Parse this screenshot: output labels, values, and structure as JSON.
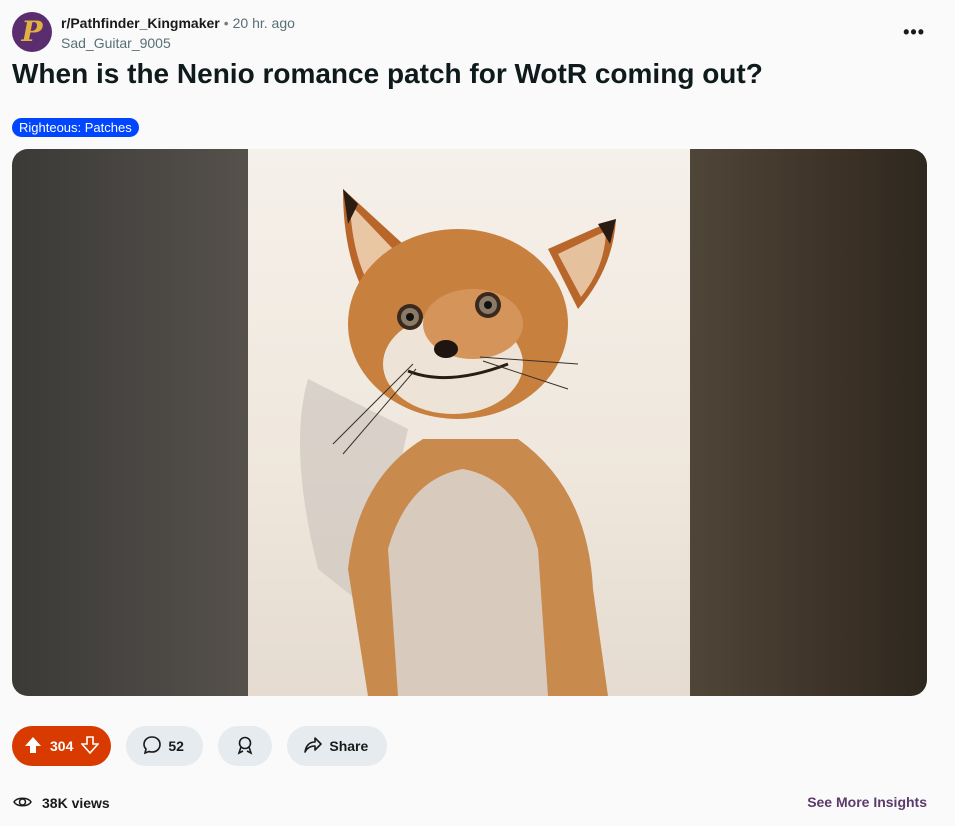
{
  "post": {
    "subreddit": "r/Pathfinder_Kingmaker",
    "separator": "•",
    "time": "20 hr. ago",
    "author": "Sad_Guitar_9005",
    "more_label": "•••",
    "title": "When is the Nenio romance patch for WotR coming out?",
    "flair": "Righteous: Patches"
  },
  "avatar": {
    "glyph": "P",
    "icon": "subreddit-avatar-icon"
  },
  "actions": {
    "votes": "304",
    "comments": "52",
    "award_icon": "award-icon",
    "share_label": "Share"
  },
  "footer": {
    "views": "38K views",
    "insights_label": "See More Insights"
  },
  "colors": {
    "vote_bg": "#d93a00",
    "flair_bg": "#0045ff",
    "pill_bg": "#e5ebee",
    "insights": "#5c3a6b"
  }
}
